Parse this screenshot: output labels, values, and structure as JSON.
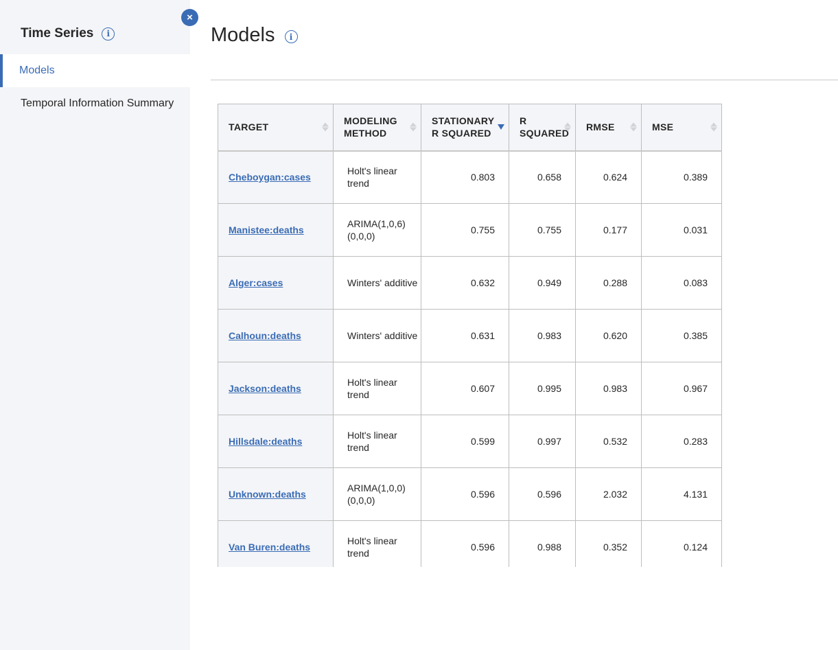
{
  "sidebar": {
    "title": "Time Series",
    "items": [
      {
        "label": "Models",
        "active": true
      },
      {
        "label": "Temporal Information Summary",
        "active": false
      }
    ]
  },
  "close_button": {
    "label": "×"
  },
  "info_icon_glyph": "i",
  "main": {
    "title": "Models"
  },
  "table": {
    "columns": [
      {
        "label": "TARGET",
        "sort": "none"
      },
      {
        "label": "MODELING METHOD",
        "sort": "none"
      },
      {
        "label": "STATIONARY R SQUARED",
        "sort": "descending"
      },
      {
        "label": "R SQUARED",
        "sort": "none"
      },
      {
        "label": "RMSE",
        "sort": "none"
      },
      {
        "label": "MSE",
        "sort": "none"
      }
    ],
    "rows": [
      {
        "target": "Cheboygan:cases",
        "method": "Holt's linear trend",
        "stationary_r2": "0.803",
        "r2": "0.658",
        "rmse": "0.624",
        "mse": "0.389"
      },
      {
        "target": "Manistee:deaths",
        "method": "ARIMA(1,0,6)(0,0,0)",
        "stationary_r2": "0.755",
        "r2": "0.755",
        "rmse": "0.177",
        "mse": "0.031"
      },
      {
        "target": "Alger:cases",
        "method": "Winters' additive",
        "stationary_r2": "0.632",
        "r2": "0.949",
        "rmse": "0.288",
        "mse": "0.083"
      },
      {
        "target": "Calhoun:deaths",
        "method": "Winters' additive",
        "stationary_r2": "0.631",
        "r2": "0.983",
        "rmse": "0.620",
        "mse": "0.385"
      },
      {
        "target": "Jackson:deaths",
        "method": "Holt's linear trend",
        "stationary_r2": "0.607",
        "r2": "0.995",
        "rmse": "0.983",
        "mse": "0.967"
      },
      {
        "target": "Hillsdale:deaths",
        "method": "Holt's linear trend",
        "stationary_r2": "0.599",
        "r2": "0.997",
        "rmse": "0.532",
        "mse": "0.283"
      },
      {
        "target": "Unknown:deaths",
        "method": "ARIMA(1,0,0)(0,0,0)",
        "stationary_r2": "0.596",
        "r2": "0.596",
        "rmse": "2.032",
        "mse": "4.131"
      },
      {
        "target": "Van Buren:deaths",
        "method": "Holt's linear trend",
        "stationary_r2": "0.596",
        "r2": "0.988",
        "rmse": "0.352",
        "mse": "0.124"
      }
    ]
  },
  "colors": {
    "accent": "#3a6cb5",
    "sidebar_bg": "#f4f5f8",
    "header_bg": "#f4f5f8"
  }
}
